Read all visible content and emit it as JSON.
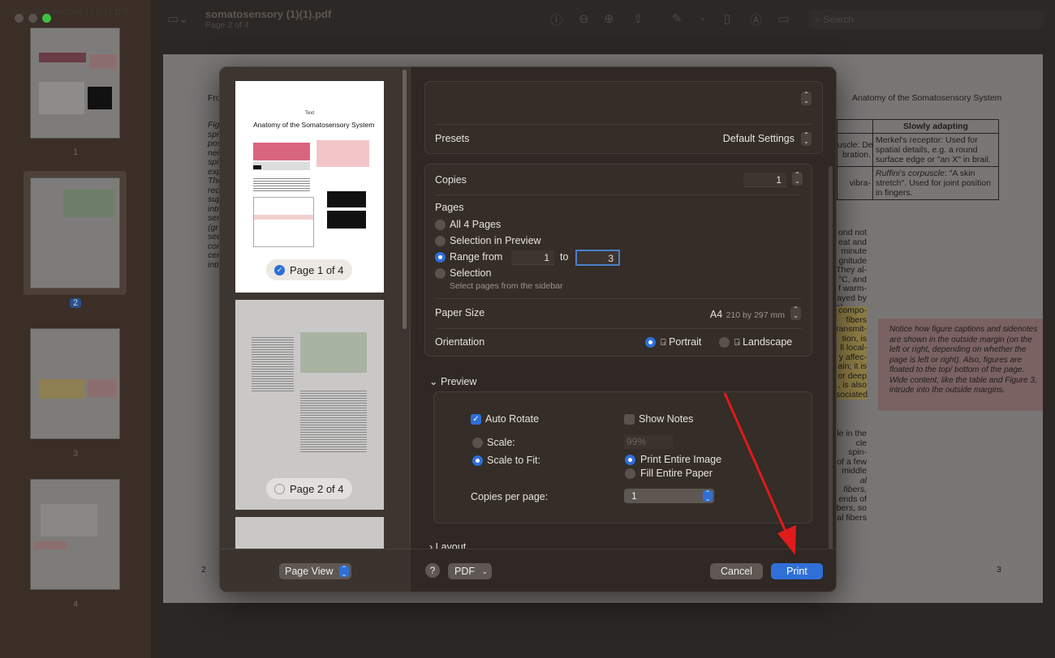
{
  "window": {
    "sidebar_title": "somatosensory (1)(1).pdf",
    "title": "somatosensory (1)(1).pdf",
    "subtitle": "Page 2 of 4",
    "search_placeholder": "Search"
  },
  "sidebar": {
    "pages": [
      {
        "label": "1"
      },
      {
        "label": "2",
        "selected": true
      },
      {
        "label": "3"
      },
      {
        "label": "4"
      }
    ]
  },
  "document": {
    "header_right": "Anatomy of the Somatosensory System",
    "header_left": "Fro",
    "page_left_number": "2",
    "page_right_number": "3",
    "table_header": "Slowly adapting",
    "table_rows": [
      {
        "left": "uscle: De\nbration.",
        "right": "Merkel's receptor: Used for spatial details, e.g. a round surface edge or \"an X\" in brail."
      },
      {
        "left": "vibra-",
        "right_italic": "Ruffini's corpuscle",
        "right": ": \"A skin stretch\". Used for joint position in fingers."
      }
    ],
    "body_fragments_1": [
      "ond not",
      "eat and",
      "minute",
      "gnitude",
      "They al-",
      "°C, and",
      "f warm-",
      "ayed by",
      "s)."
    ],
    "body_fragments_highlight": [
      "compo-",
      "fibers",
      "ransmit-",
      "tion, is",
      "ll local-",
      "y affec-",
      "ain; it is",
      "or deep",
      ", is also",
      "sociated"
    ],
    "body_fragments_2": [
      "le in the",
      "cle spin-",
      "of a few",
      "middle",
      "al fibers,",
      "ends of",
      "bers, so",
      "al fibers"
    ],
    "left_fragments": [
      "Fig",
      "spi",
      "pos",
      "nei",
      "spi",
      "exp",
      "The",
      "rec",
      "sup",
      "intr",
      "ser",
      "(gr",
      "sec",
      "cor",
      "cer",
      "intr"
    ],
    "sidenote": "Notice how figure captions and sidenotes are shown in the outside margin (on the left or right, depending on whether the page is left or right). Also, figures are floated to the top/ bottom of the page. Wide content, like the table and Figure 3, intrude into the outside margins."
  },
  "print_dialog": {
    "preview_pages": [
      {
        "badge": "Page 1 of 4",
        "checked": true,
        "doc_title": "Anatomy of the Somatosensory System",
        "top_text": "Text"
      },
      {
        "badge": "Page 2 of 4",
        "checked": false
      }
    ],
    "page_view_label": "Page View",
    "presets_label": "Presets",
    "presets_value": "Default Settings",
    "copies_label": "Copies",
    "copies_value": "1",
    "pages_label": "Pages",
    "pages_options": [
      {
        "label": "All 4 Pages",
        "selected": false
      },
      {
        "label": "Selection in Preview",
        "selected": false
      },
      {
        "label": "Range from",
        "selected": true
      },
      {
        "label": "Selection",
        "selected": false
      }
    ],
    "range_from": "1",
    "range_to_label": "to",
    "range_to": "3",
    "selection_hint": "Select pages from the sidebar",
    "paper_size_label": "Paper Size",
    "paper_size_value": "A4",
    "paper_size_detail": "210 by 297 mm",
    "orientation_label": "Orientation",
    "orientation_portrait": "Portrait",
    "orientation_landscape": "Landscape",
    "orientation_selected": "Portrait",
    "preview_section": "Preview",
    "auto_rotate": "Auto Rotate",
    "auto_rotate_checked": true,
    "show_notes": "Show Notes",
    "show_notes_checked": false,
    "scale_label": "Scale:",
    "scale_value": "99%",
    "scale_to_fit": "Scale to Fit:",
    "scale_mode": "Scale to Fit",
    "print_entire_image": "Print Entire Image",
    "fill_entire_paper": "Fill Entire Paper",
    "fit_mode": "Print Entire Image",
    "copies_per_page_label": "Copies per page:",
    "copies_per_page_value": "1",
    "layout_section": "Layout",
    "help": "?",
    "pdf": "PDF",
    "cancel": "Cancel",
    "print": "Print"
  },
  "colors": {
    "accent": "#2f6fd8",
    "annotation_arrow": "#e01b1b"
  }
}
